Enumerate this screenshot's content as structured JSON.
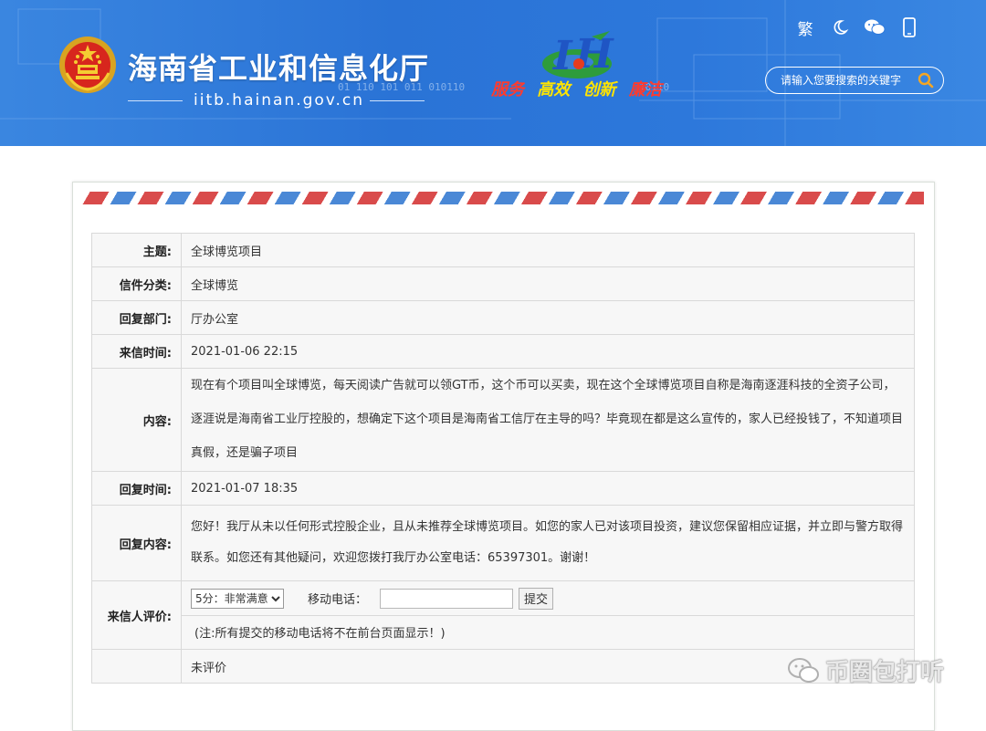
{
  "header": {
    "site_title": "海南省工业和信息化厅",
    "site_domain": "iitb.hainan.gov.cn",
    "slogan": [
      "服务",
      "高效",
      "创新",
      "廉洁"
    ],
    "slogan_colors": [
      "#ff3b2e",
      "#ffe400",
      "#ffe400",
      "#ff3b2e"
    ],
    "search": {
      "placeholder": "请输入您要搜索的关键字"
    },
    "toolbar": {
      "traditional_label": "繁"
    }
  },
  "letter": {
    "rows": {
      "subject": {
        "label": "主题:",
        "value": "全球博览项目"
      },
      "category": {
        "label": "信件分类:",
        "value": "全球博览"
      },
      "department": {
        "label": "回复部门:",
        "value": "厅办公室"
      },
      "received_time": {
        "label": "来信时间:",
        "value": "2021-01-06 22:15"
      },
      "content": {
        "label": "内容:",
        "value": "现在有个项目叫全球博览，每天阅读广告就可以领GT币，这个币可以买卖，现在这个全球博览项目自称是海南逐涯科技的全资子公司，逐涯说是海南省工业厅控股的，想确定下这个项目是海南省工信厅在主导的吗？毕竟现在都是这么宣传的，家人已经投钱了，不知道项目真假，还是骗子项目"
      },
      "reply_time": {
        "label": "回复时间:",
        "value": "2021-01-07 18:35"
      },
      "reply_content": {
        "label": "回复内容:",
        "value": "您好！我厅从未以任何形式控股企业，且从未推荐全球博览项目。如您的家人已对该项目投资，建议您保留相应证据，并立即与警方取得联系。如您还有其他疑问，欢迎您拨打我厅办公室电话：65397301。谢谢！"
      },
      "rating": {
        "label": "来信人评价:",
        "selected_option": "5分：非常满意",
        "phone_label": "移动电话：",
        "phone_value": "",
        "submit_label": "提交",
        "note": "(注:所有提交的移动电话将不在前台页面显示！)"
      },
      "rating_status": {
        "value": "未评价"
      }
    }
  },
  "watermark": {
    "text": "币圈包打听"
  }
}
